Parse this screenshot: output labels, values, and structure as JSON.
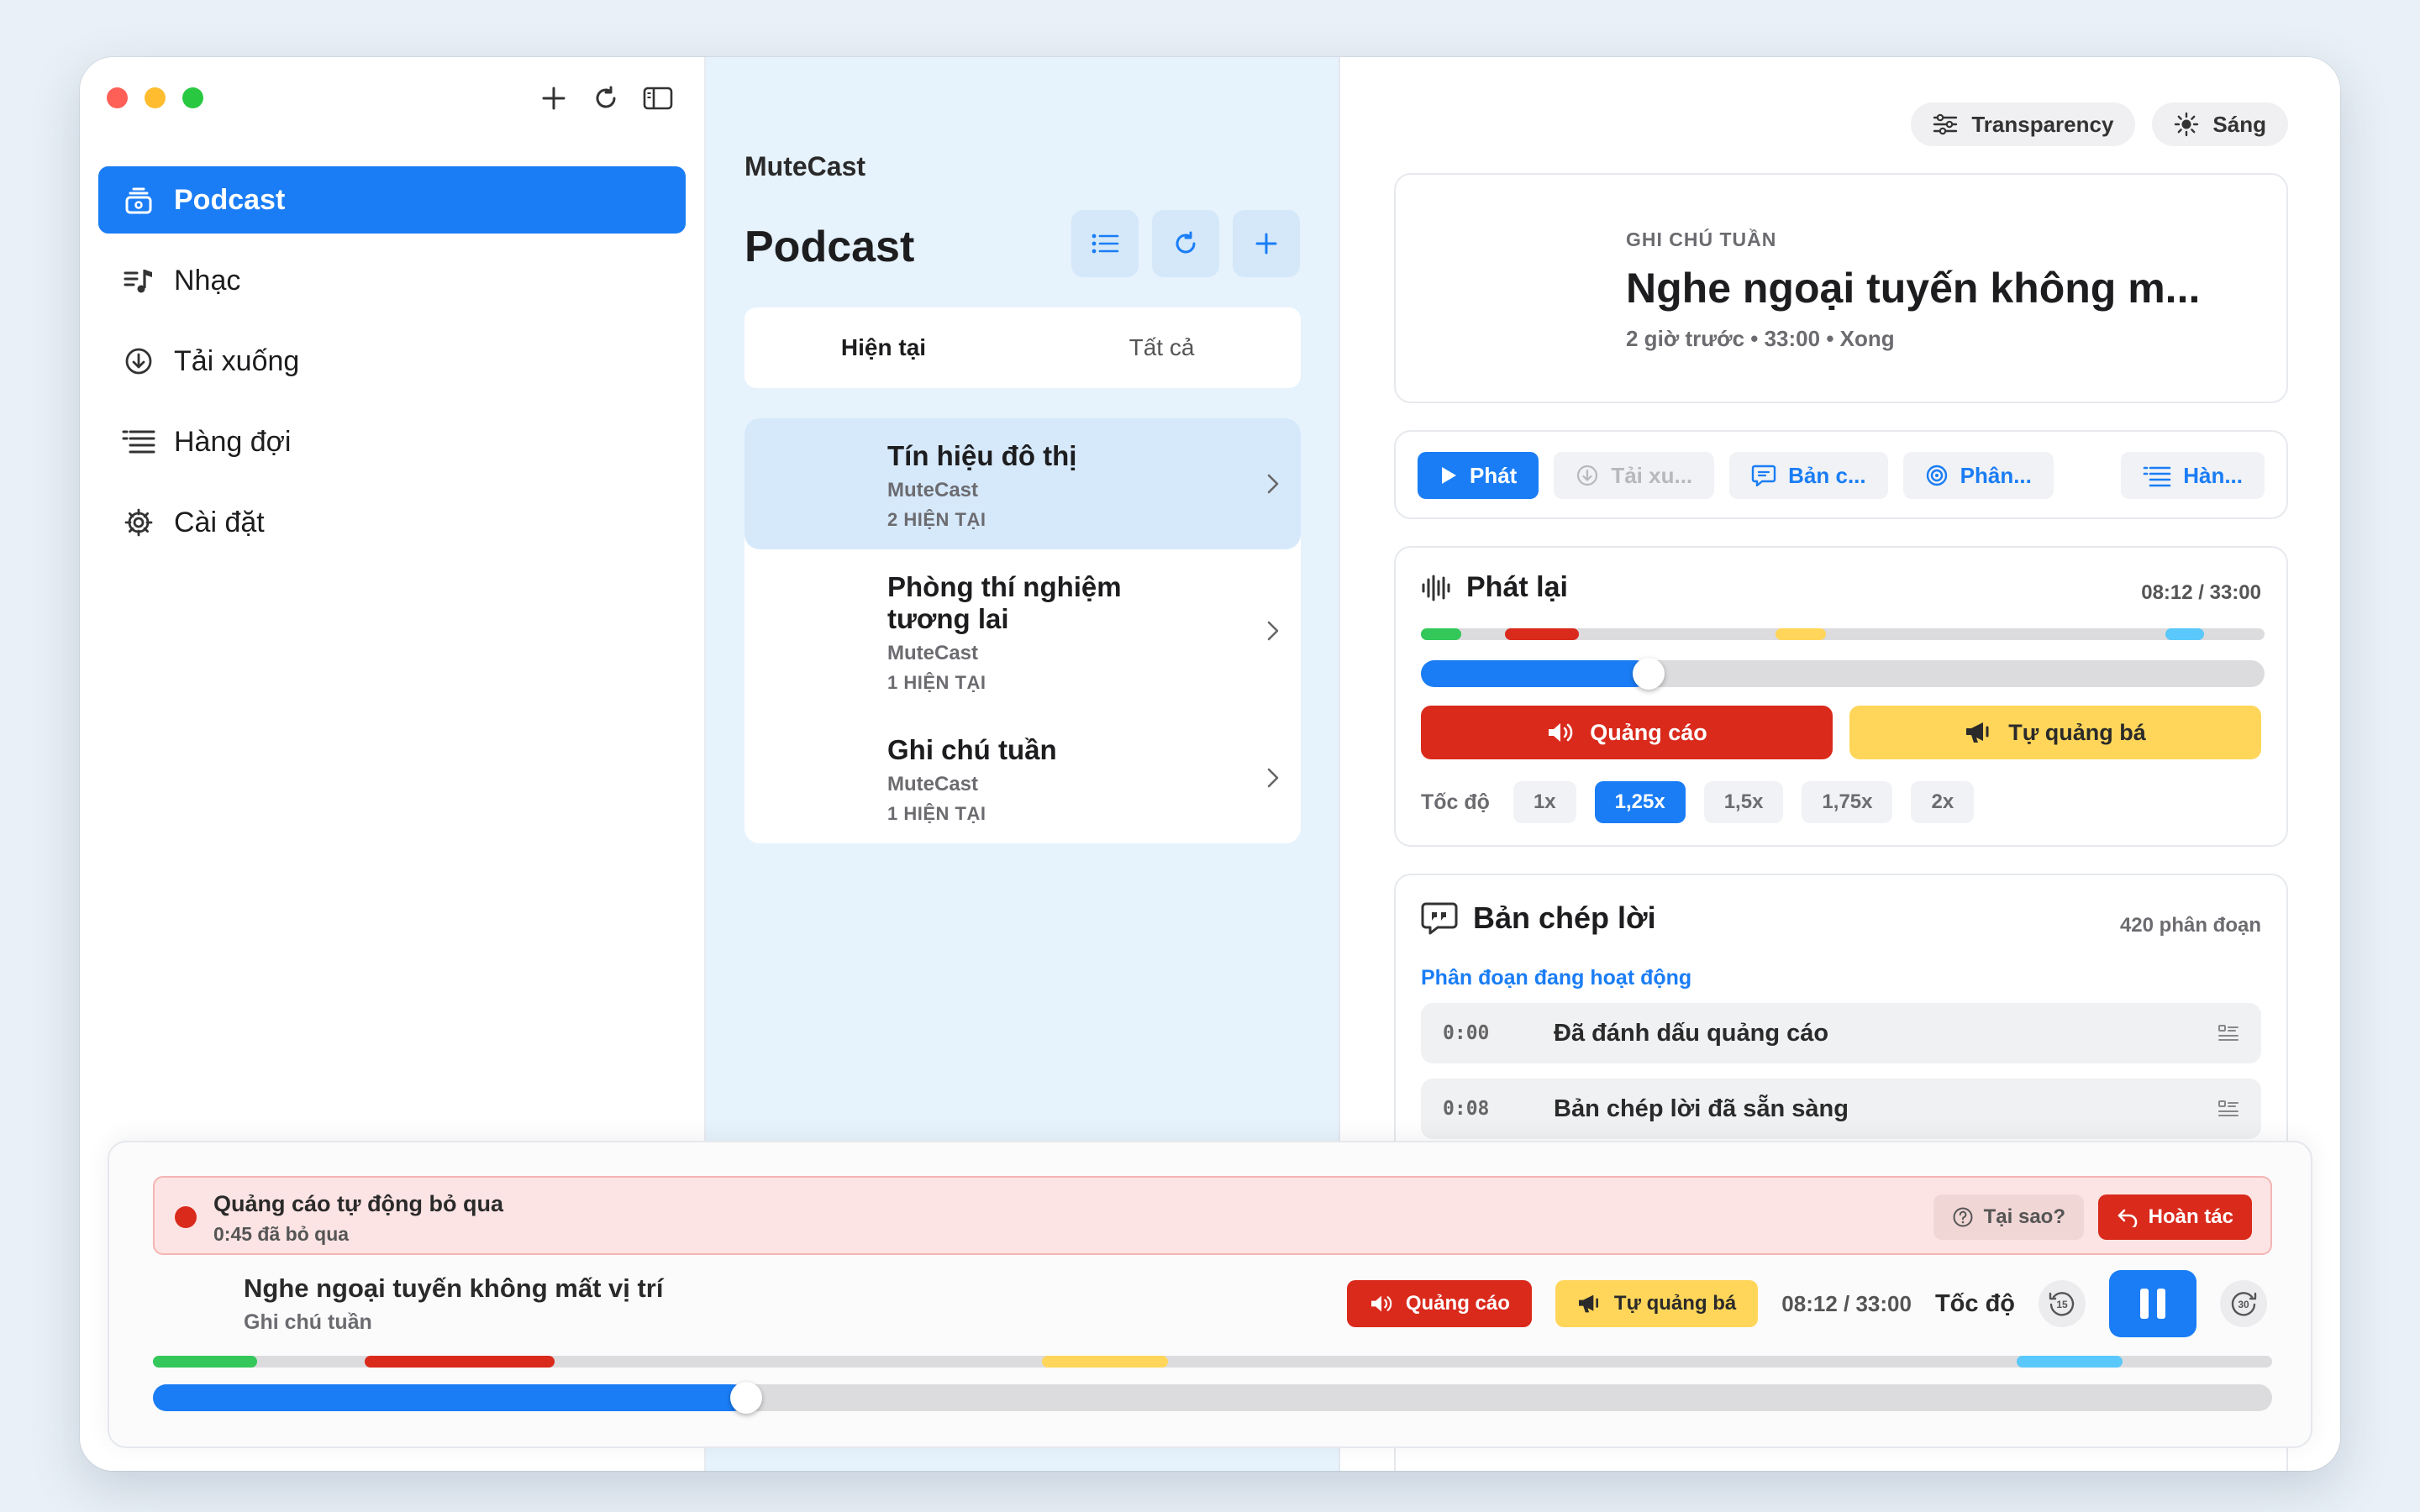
{
  "sidebar": {
    "items": [
      {
        "label": "Podcast",
        "icon": "podcast-stack-icon",
        "active": true
      },
      {
        "label": "Nhạc",
        "icon": "music-note-icon",
        "active": false
      },
      {
        "label": "Tải xuống",
        "icon": "download-circle-icon",
        "active": false
      },
      {
        "label": "Hàng đợi",
        "icon": "queue-list-icon",
        "active": false
      },
      {
        "label": "Cài đặt",
        "icon": "gear-icon",
        "active": false
      }
    ]
  },
  "list": {
    "app_name": "MuteCast",
    "title": "Podcast",
    "tabs": [
      "Hiện tại",
      "Tất cả"
    ],
    "shows": [
      {
        "title": "Tín hiệu đô thị",
        "author": "MuteCast",
        "count": "2 HIỆN TẠI"
      },
      {
        "title": "Phòng thí nghiệm tương lai",
        "author": "MuteCast",
        "count": "1 HIỆN TẠI"
      },
      {
        "title": "Ghi chú tuần",
        "author": "MuteCast",
        "count": "1 HIỆN TẠI"
      }
    ]
  },
  "detail": {
    "pills": {
      "transparency": "Transparency",
      "theme": "Sáng"
    },
    "episode": {
      "kicker": "GHI CHÚ TUẦN",
      "title": "Nghe ngoại tuyến không m...",
      "meta": "2 giờ trước • 33:00 • Xong"
    },
    "actions": {
      "play": "Phát",
      "download": "Tải xu...",
      "transcript": "Bản c...",
      "analyze": "Phân...",
      "queue": "Hàn..."
    },
    "playback": {
      "title": "Phát lại",
      "time": "08:12 / 33:00",
      "progress": 0.27,
      "ad_label": "Quảng cáo",
      "promo_label": "Tự quảng bá",
      "speed_label": "Tốc độ",
      "speeds": [
        "1x",
        "1,25x",
        "1,5x",
        "1,75x",
        "2x"
      ],
      "selected_speed": "1,25x"
    },
    "transcript": {
      "title": "Bản chép lời",
      "count": "420 phân đoạn",
      "active_label": "Phân đoạn đang hoạt động",
      "rows": [
        {
          "time": "0:00",
          "text": "Đã đánh dấu quảng cáo"
        },
        {
          "time": "0:08",
          "text": "Bản chép lời đã sẵn sàng"
        }
      ]
    }
  },
  "player": {
    "banner_title": "Quảng cáo tự động bỏ qua",
    "banner_sub": "0:45 đã bỏ qua",
    "why_label": "Tại sao?",
    "undo_label": "Hoàn tác",
    "now_title": "Nghe ngoại tuyến không mất vị trí",
    "now_show": "Ghi chú tuần",
    "ad_label": "Quảng cáo",
    "promo_label": "Tự quảng bá",
    "time": "08:12 / 33:00",
    "speed_label": "Tốc độ",
    "skip_back": "15",
    "skip_forward": "30",
    "progress": 0.28
  },
  "colors": {
    "accent": "#1a7df5",
    "ad": "#d92a1c",
    "promo": "#ffd65a",
    "intro": "#34c759",
    "outro": "#5ac8fa"
  }
}
